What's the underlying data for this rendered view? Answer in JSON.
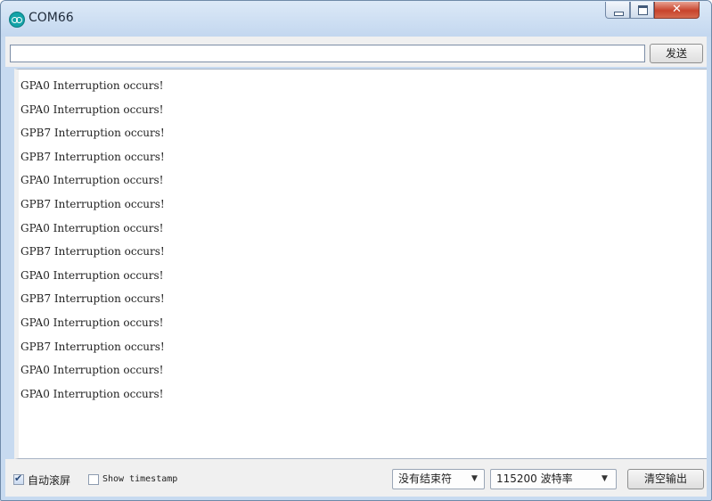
{
  "window": {
    "title": "COM66"
  },
  "input": {
    "value": "",
    "send_label": "发送"
  },
  "output": {
    "lines": [
      "GPA0 Interruption occurs!",
      "GPA0 Interruption occurs!",
      "GPB7 Interruption occurs!",
      "GPB7 Interruption occurs!",
      "GPA0 Interruption occurs!",
      "GPB7 Interruption occurs!",
      "GPA0 Interruption occurs!",
      "GPB7 Interruption occurs!",
      "GPA0 Interruption occurs!",
      "GPB7 Interruption occurs!",
      "GPA0 Interruption occurs!",
      "GPB7 Interruption occurs!",
      "GPA0 Interruption occurs!",
      "GPA0 Interruption occurs!"
    ]
  },
  "status": {
    "autoscroll": {
      "label": "自动滚屏",
      "checked": true
    },
    "timestamp": {
      "label": "Show timestamp",
      "checked": false
    },
    "line_ending": {
      "value": "没有结束符"
    },
    "baud": {
      "value": "115200 波特率"
    },
    "clear_label": "清空输出"
  },
  "icons": {
    "app": "arduino-icon",
    "minimize": "minimize-icon",
    "maximize": "maximize-icon",
    "close": "close-icon",
    "dropdown": "chevron-down-icon"
  },
  "colors": {
    "close_button": "#c8432c",
    "frame": "#c7daf0",
    "app_icon": "#14a3a8"
  }
}
